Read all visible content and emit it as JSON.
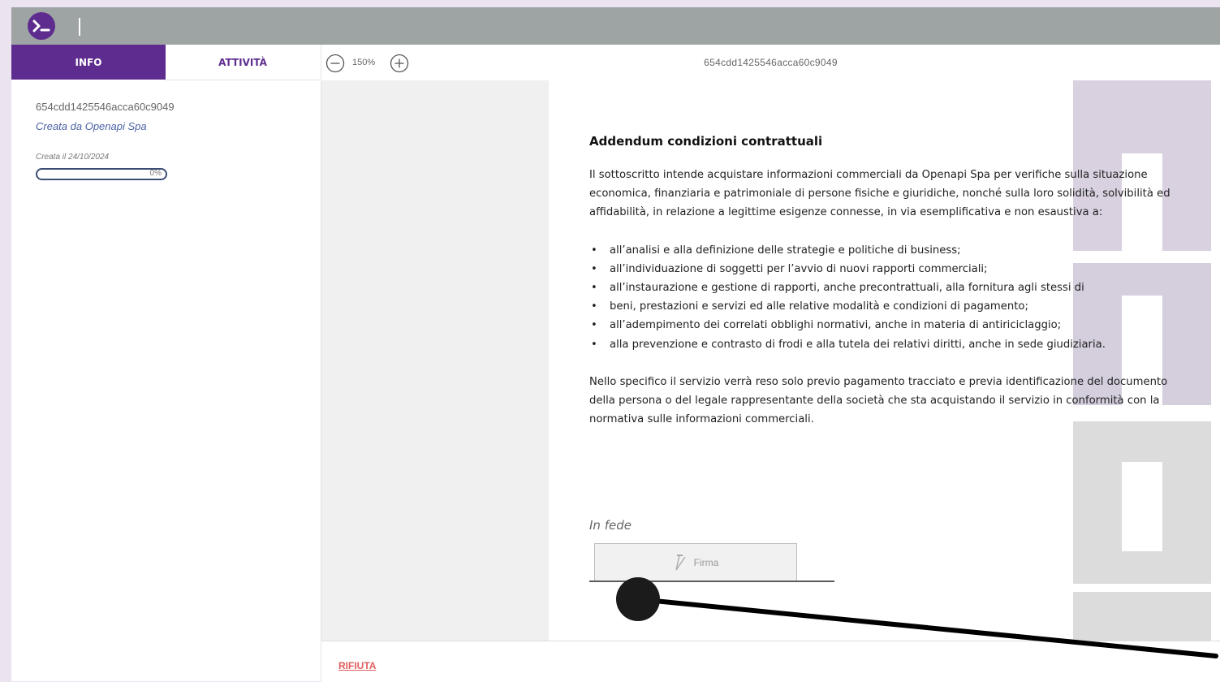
{
  "app": {
    "logo_icon": "terminal-prompt-icon",
    "brand_color": "#5d2c8e",
    "topbar_color": "#9ea4a3"
  },
  "sidebar": {
    "tabs": [
      {
        "label": "INFO",
        "active": true
      },
      {
        "label": "ATTIVITÀ",
        "active": false
      }
    ],
    "doc_id": "654cdd1425546acca60c9049",
    "creator": "Creata da Openapi Spa",
    "created_at": "Creata il 24/10/2024",
    "progress": {
      "label": "0%",
      "value_percent": 0
    }
  },
  "toolbar": {
    "zoom_out_icon": "minus-circle-icon",
    "zoom_level": "150%",
    "zoom_in_icon": "plus-circle-icon",
    "title": "654cdd1425546acca60c9049"
  },
  "document": {
    "title": "Addendum condizioni contrattuali",
    "intro": "Il sottoscritto intende acquistare informazioni commerciali da Openapi Spa per verifiche sulla situazione economica, finanziaria e patrimoniale di persone fisiche e giuridiche, nonché sulla loro solidità, solvibilità ed affidabilità, in relazione a legittime esigenze connesse, in via esemplificativa e non esaustiva a:",
    "bullets": [
      "all’analisi e alla definizione delle strategie e politiche di business;",
      "all’individuazione di soggetti per l’avvio di nuovi rapporti commerciali;",
      "all’instaurazione e gestione di rapporti, anche precontrattuali, alla fornitura agli stessi di",
      "beni, prestazioni e servizi ed alle relative modalità e condizioni di pagamento;",
      "all’adempimento dei correlati obblighi normativi, anche in materia di antiriciclaggio;",
      "alla prevenzione e contrasto di frodi e alla tutela dei relativi diritti, anche in sede giudiziaria."
    ],
    "closing": "Nello specifico il servizio verrà reso solo previo pagamento tracciato e previa identificazione del documento della persona o del legale rappresentante della società che sta acquistando il servizio in conformità con la normativa sulle informazioni commerciali.",
    "signature_label": "In fede",
    "sign_button": "Firma",
    "sign_icon": "pen-icon",
    "watermark": "openapi"
  },
  "footer": {
    "reject": "RIFIUTA"
  }
}
